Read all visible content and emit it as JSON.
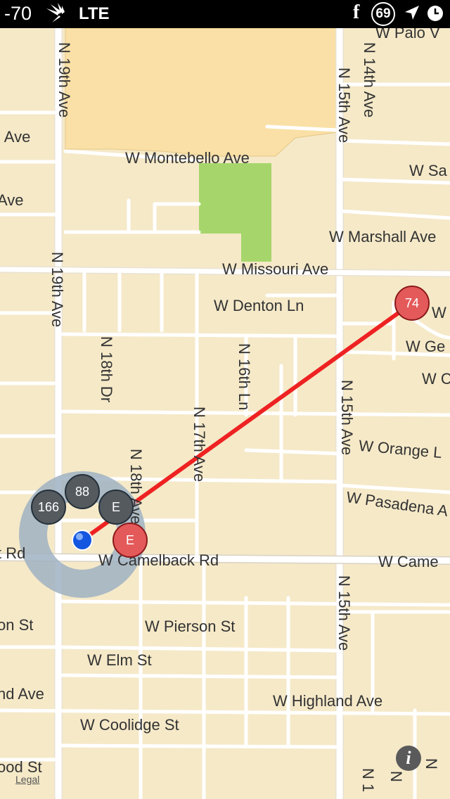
{
  "status_bar": {
    "signal": "-70",
    "network": "LTE",
    "facebook": "f",
    "notification_count": "69"
  },
  "map": {
    "streets": {
      "n19th_top": "N 19th Ave",
      "ave_left1": "Ave",
      "ave_left1b": "l Ave",
      "w_montebello": "W Montebello Ave",
      "ave_left2": "Ave",
      "w_sa": "W Sa",
      "w_marshall": "W Marshall Ave",
      "w_missouri": "W Missouri Ave",
      "w_denton": "W Denton Ln",
      "w_palo_v": "W Palo V",
      "n14th": "N 14th Ave",
      "n15th_top": "N 15th Ave",
      "n19th_mid": "N 19th Ave",
      "n18th_dr": "N 18th Dr",
      "n16th_ln": "N 16th Ln",
      "n17th_ave": "N 17th Ave",
      "n18th_ave": "N 18th Ave",
      "n15th_mid": "N 15th Ave",
      "w_ge": "W Ge",
      "w_c": "W C",
      "w_w": "W",
      "w_orange": "W Orange L",
      "w_pasadena": "W Pasadena A",
      "rd_left": "t Rd",
      "w_camelback": "W Camelback Rd",
      "w_came_right": "W Came",
      "n15th_bottom": "N 15th Ave",
      "on_st": "on St",
      "w_pierson": "W Pierson St",
      "w_elm": "W Elm St",
      "nd_ave": "nd Ave",
      "w_highland": "W Highland Ave",
      "w_coolidge": "W Coolidge St",
      "ood_st": "ood St",
      "n14_bottom": "N 1",
      "n_bottom2": "N",
      "n_bottom3": "N"
    },
    "markers": {
      "node_166": "166",
      "node_88": "88",
      "node_e_dark": "E",
      "node_e_red": "E",
      "node_74": "74"
    },
    "legal": "Legal",
    "info": "i",
    "colors": {
      "land": "#f5e9c8",
      "park_sand": "#fae0a6",
      "park_green": "#a6d66b",
      "road": "#ffffff",
      "route": "#ee2222",
      "marker_red": "#e45a5a",
      "marker_dark": "#555a5f"
    }
  }
}
